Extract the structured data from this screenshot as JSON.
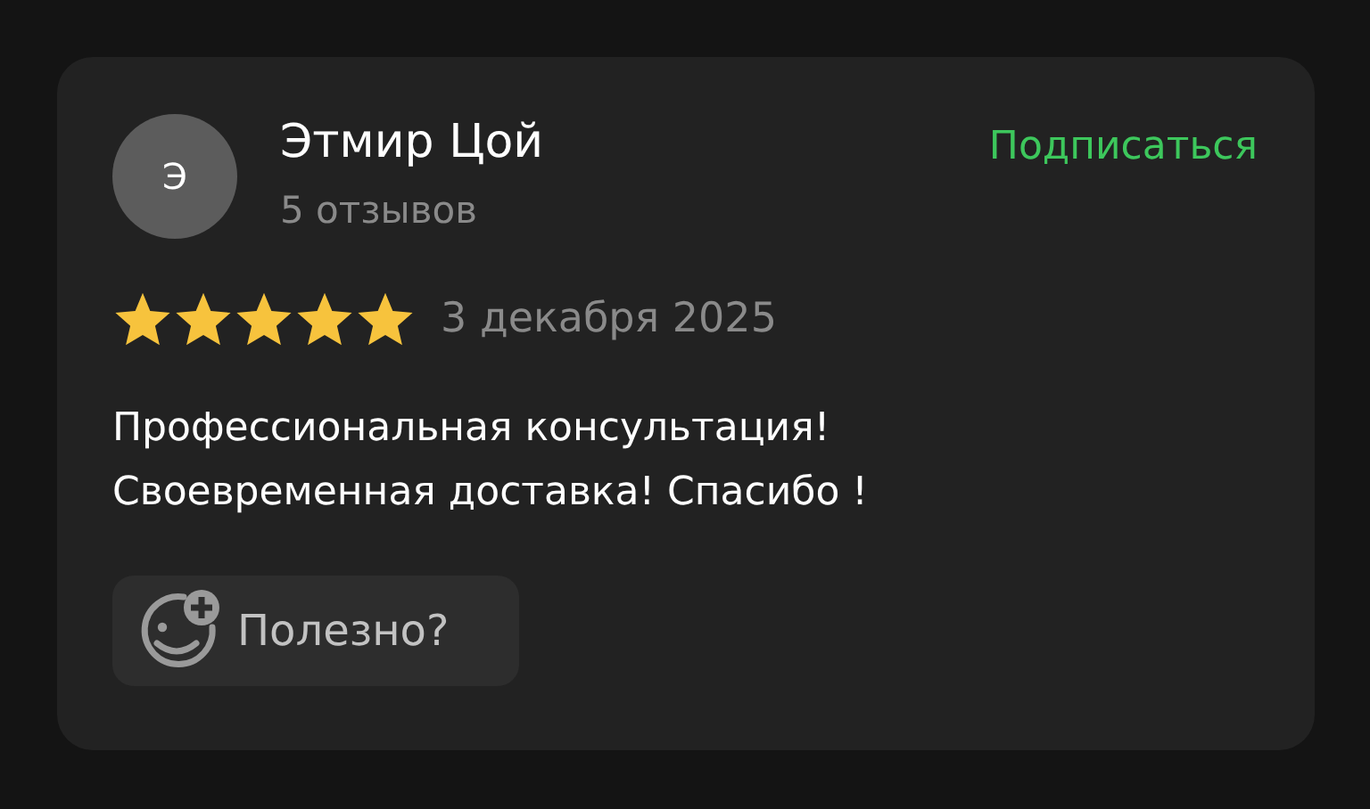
{
  "review": {
    "avatar_initial": "Э",
    "author": "Этмир Цой",
    "reviews_count": "5 отзывов",
    "subscribe": "Подписаться",
    "stars": 5,
    "date": "3 декабря 2025",
    "text": "Профессиональная консультация! Своевременная доставка! Спасибо !",
    "helpful": "Полезно?"
  }
}
